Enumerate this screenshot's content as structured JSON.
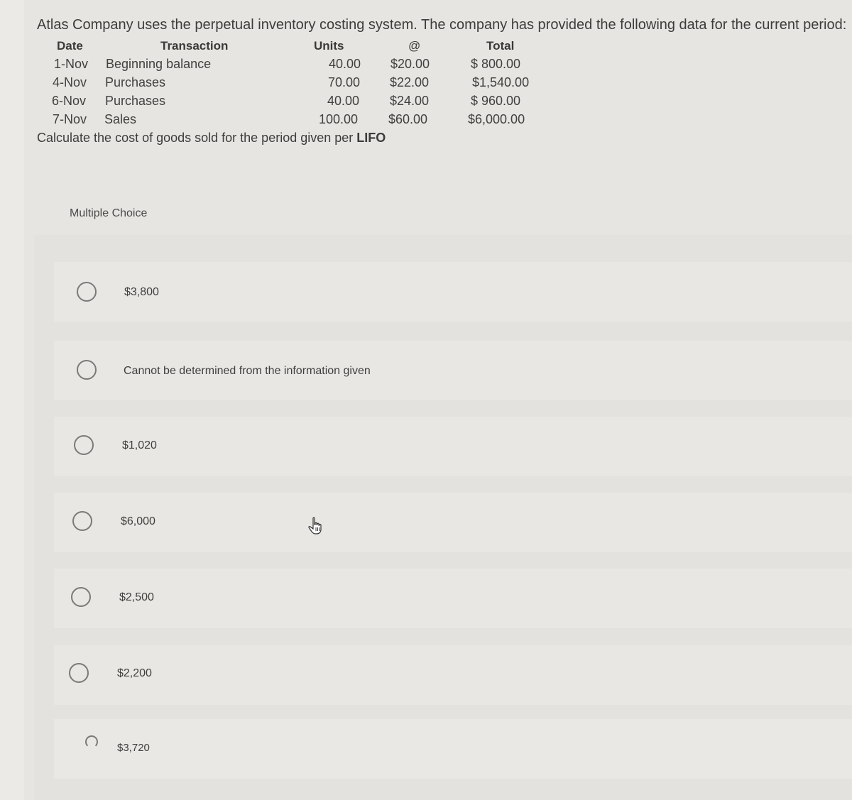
{
  "question": {
    "text": "Atlas Company uses the perpetual inventory costing system. The company has provided the following data for the current period:",
    "table": {
      "headers": {
        "date": "Date",
        "transaction": "Transaction",
        "units": "Units",
        "at": "@",
        "total": "Total"
      },
      "rows": [
        {
          "date": "1-Nov",
          "transaction": "Beginning balance",
          "units": "40.00",
          "at": "$20.00",
          "total": "$ 800.00"
        },
        {
          "date": "4-Nov",
          "transaction": "Purchases",
          "units": "70.00",
          "at": "$22.00",
          "total": "$1,540.00"
        },
        {
          "date": "6-Nov",
          "transaction": "Purchases",
          "units": "40.00",
          "at": "$24.00",
          "total": "$ 960.00"
        },
        {
          "date": "7-Nov",
          "transaction": "Sales",
          "units": "100.00",
          "at": "$60.00",
          "total": "$6,000.00"
        }
      ]
    },
    "prompt_prefix": "Calculate the cost of goods sold for the period given per ",
    "prompt_method": "LIFO"
  },
  "multiple_choice": {
    "label": "Multiple Choice",
    "options": [
      {
        "label": "$3,800",
        "selected": false
      },
      {
        "label": "Cannot be determined from the information given",
        "selected": false
      },
      {
        "label": "$1,020",
        "selected": false
      },
      {
        "label": "$6,000",
        "selected": false
      },
      {
        "label": "$2,500",
        "selected": false
      },
      {
        "label": "$2,200",
        "selected": false
      },
      {
        "label": "$3,720",
        "selected": false
      }
    ]
  },
  "cursor": {
    "icon": "hand-pointer-icon"
  }
}
